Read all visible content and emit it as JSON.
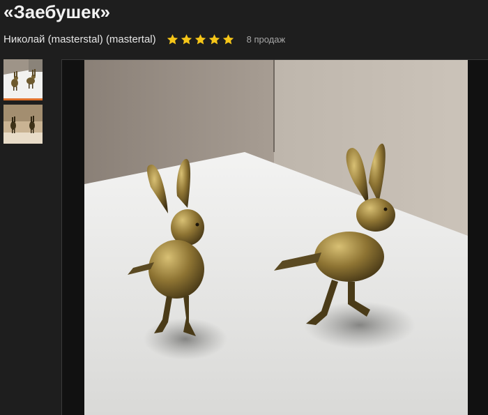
{
  "product": {
    "title": "«Заебушек»"
  },
  "seller": {
    "name": "Николай (masterstal) (mastertal)",
    "rating": 5,
    "rating_max": 5,
    "sales": "8 продаж"
  },
  "colors": {
    "background": "#1e1e1e",
    "star": "#f5c518",
    "active_thumb_border": "#e0702a"
  },
  "gallery": {
    "thumbnails": [
      {
        "icon": "photo-two-figurines-front",
        "active": true
      },
      {
        "icon": "photo-two-figurines-warm",
        "active": false
      }
    ],
    "main_photo": "photo-two-brass-hare-bird-figurines"
  }
}
